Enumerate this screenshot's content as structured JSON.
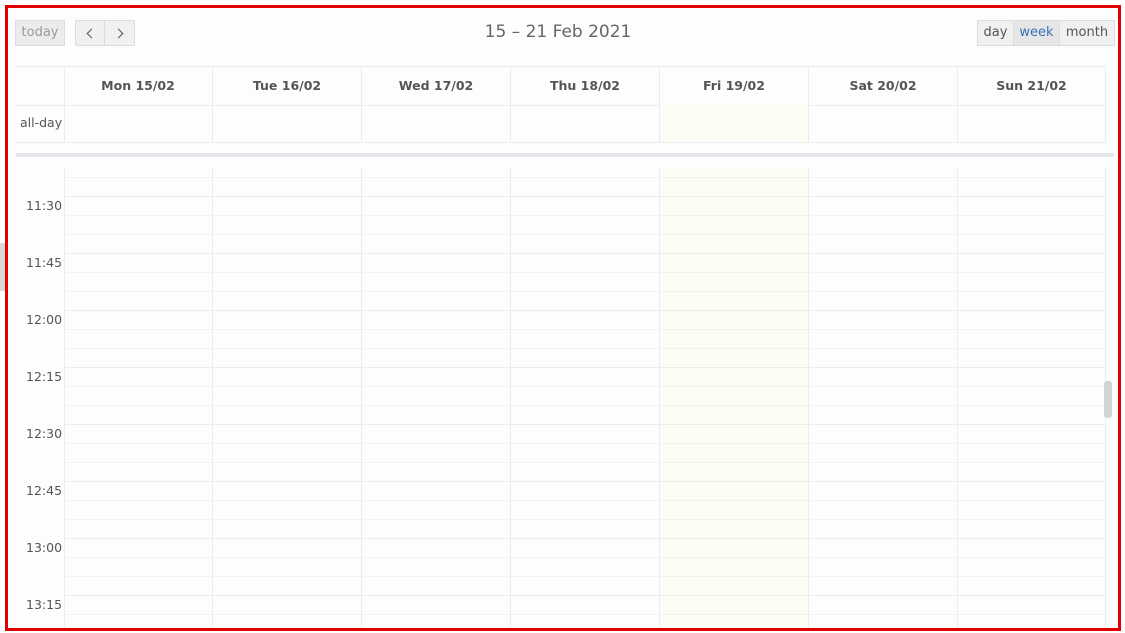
{
  "toolbar": {
    "today_label": "today",
    "prev_icon": "chevron-left-icon",
    "next_icon": "chevron-right-icon",
    "title": "15 – 21 Feb 2021",
    "views": {
      "day": "day",
      "week": "week",
      "month": "month"
    },
    "active_view": "week"
  },
  "header": {
    "days": [
      {
        "label": "Mon 15/02"
      },
      {
        "label": "Tue 16/02"
      },
      {
        "label": "Wed 17/02"
      },
      {
        "label": "Thu 18/02"
      },
      {
        "label": "Fri 19/02"
      },
      {
        "label": "Sat 20/02"
      },
      {
        "label": "Sun 21/02"
      }
    ],
    "allday_label": "all-day",
    "today_index": 4
  },
  "timegrid": {
    "slots": [
      "11:30",
      "11:45",
      "12:00",
      "12:15",
      "12:30",
      "12:45",
      "13:00",
      "13:15"
    ]
  },
  "colors": {
    "accent": "#3a6fb5",
    "frame": "#e00000",
    "today_bg": "#fdfdf5"
  }
}
